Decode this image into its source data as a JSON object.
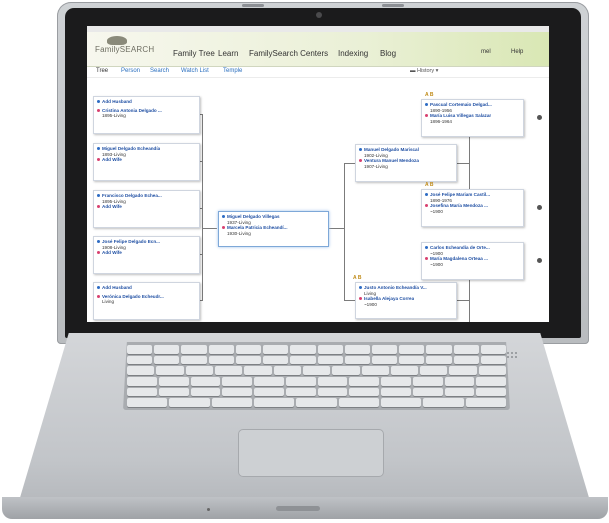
{
  "header": {
    "logo_text": "FamilySEARCH",
    "nav": [
      "Family Tree",
      "Learn",
      "FamilySearch Centers",
      "Indexing",
      "Blog"
    ],
    "user_label": "mel",
    "help_label": "Help"
  },
  "subnav": {
    "tabs": [
      "Tree",
      "Person",
      "Search",
      "Watch List",
      "Temple"
    ],
    "history_label": "History"
  },
  "gen1": [
    {
      "name": "Add Husband",
      "sex": "m",
      "dates": "",
      "spouse": {
        "name": "Cristina Antonia Delgado ...",
        "sex": "f",
        "dates": "1895-Living"
      }
    },
    {
      "name": "Miguel Delgado Echeandía",
      "sex": "m",
      "dates": "1893-Living",
      "spouse": {
        "name": "Add Wife",
        "sex": "f",
        "dates": ""
      }
    },
    {
      "name": "Francisco Delgado Echea...",
      "sex": "m",
      "dates": "1895-Living",
      "spouse": {
        "name": "Add Wife",
        "sex": "f",
        "dates": ""
      }
    },
    {
      "name": "José Felipe Delgado Ecn...",
      "sex": "m",
      "dates": "1908-Living",
      "spouse": {
        "name": "Add Wife",
        "sex": "f",
        "dates": ""
      }
    },
    {
      "name": "Add Husband",
      "sex": "m",
      "dates": "",
      "spouse": {
        "name": "Verónica Delgado Echeudr...",
        "sex": "f",
        "dates": "Living"
      }
    }
  ],
  "root": {
    "name": "Miguel Delgado Villegas",
    "sex": "m",
    "dates": "1937-Living",
    "spouse": {
      "name": "Marcela Patricia Echeandí...",
      "sex": "f",
      "dates": "1930-Living"
    }
  },
  "parents": [
    {
      "name": "Manuel Delgado Mariscal",
      "sex": "m",
      "dates": "1902-Living",
      "spouse": {
        "name": "Ventura Manuel Mendoza",
        "sex": "f",
        "dates": "1907-Living"
      }
    },
    {
      "name": "Justo Antonio Echeandía V...",
      "sex": "m",
      "dates": "Living",
      "spouse": {
        "name": "Isabella Alejaya Correa",
        "sex": "f",
        "dates": "~1900"
      }
    }
  ],
  "grandparents": [
    {
      "name": "Pascual Cortemaio Delgad...",
      "sex": "m",
      "dates": "1890-1956",
      "spouse": {
        "name": "María Luisa Villegas Salazar",
        "sex": "f",
        "dates": "1896-1964"
      }
    },
    {
      "name": "José Felipe Mariam Castil...",
      "sex": "m",
      "dates": "1890-1976",
      "spouse": {
        "name": "Josefina María Mendoza ...",
        "sex": "f",
        "dates": "~1900"
      }
    },
    {
      "name": "Carlos Echeandía de Orte...",
      "sex": "m",
      "dates": "~1900",
      "spouse": {
        "name": "María Magdalena Orteaa ...",
        "sex": "f",
        "dates": "~1900"
      }
    }
  ],
  "flags": [
    "A B",
    "A B",
    "A B"
  ],
  "colors": {
    "male": "#2d6cc4",
    "female": "#d8406f",
    "link": "#2a6fbf"
  }
}
